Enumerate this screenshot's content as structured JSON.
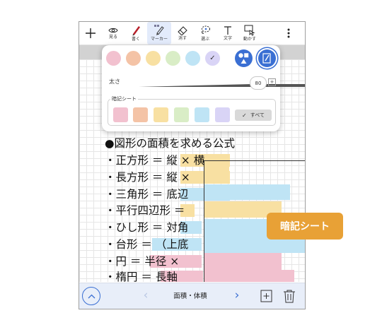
{
  "toolbar": {
    "tools": [
      {
        "label": "",
        "icon": "plus-icon"
      },
      {
        "label": "見る",
        "icon": "eye-icon"
      },
      {
        "label": "書く",
        "icon": "pen-icon"
      },
      {
        "label": "マーカー",
        "icon": "marker-icon"
      },
      {
        "label": "消す",
        "icon": "eraser-icon"
      },
      {
        "label": "選ぶ",
        "icon": "lasso-icon"
      },
      {
        "label": "文字",
        "icon": "text-icon"
      },
      {
        "label": "動かす",
        "icon": "hand-move-icon"
      },
      {
        "label": "",
        "icon": "more-vertical-icon"
      }
    ]
  },
  "popup": {
    "pen_colors": [
      "#f2c1cf",
      "#f4c3a6",
      "#f8e0a2",
      "#d9edc6",
      "#bfe4f5",
      "#d9d4f6"
    ],
    "selected_color_index": 5,
    "size_label": "太さ",
    "size_value": "80",
    "size_plus": "+",
    "sheet_label": "暗記シート",
    "sheet_colors": [
      "#f2c1cf",
      "#f4c3a6",
      "#f8e0a2",
      "#d9edc6",
      "#bfe4f5",
      "#d9d4f6"
    ],
    "all_label": "すべて",
    "all_check": "✓"
  },
  "note": {
    "lines": [
      "●図形の面積を求める公式",
      "・正方形 ＝ 縦 × 横",
      "・長方形 ＝ 縦 ×",
      "・三角形 ＝ 底辺",
      "・平行四辺形 ＝",
      "・ひし形 ＝ 対角",
      "・台形 ＝ （上底",
      "・円 ＝ 半径 ×",
      "・楕円 ＝ 長軸"
    ]
  },
  "bottombar": {
    "title": "面積・体積",
    "prev": "‹",
    "next": "›"
  },
  "callout": {
    "label": "暗記シート"
  },
  "colors": {
    "accent": "#3a6fd3",
    "callout": "#e8a136",
    "highlight_yellow": "#f8e0a2",
    "highlight_blue": "#bfe4f5",
    "highlight_pink": "#f2c1cf"
  }
}
